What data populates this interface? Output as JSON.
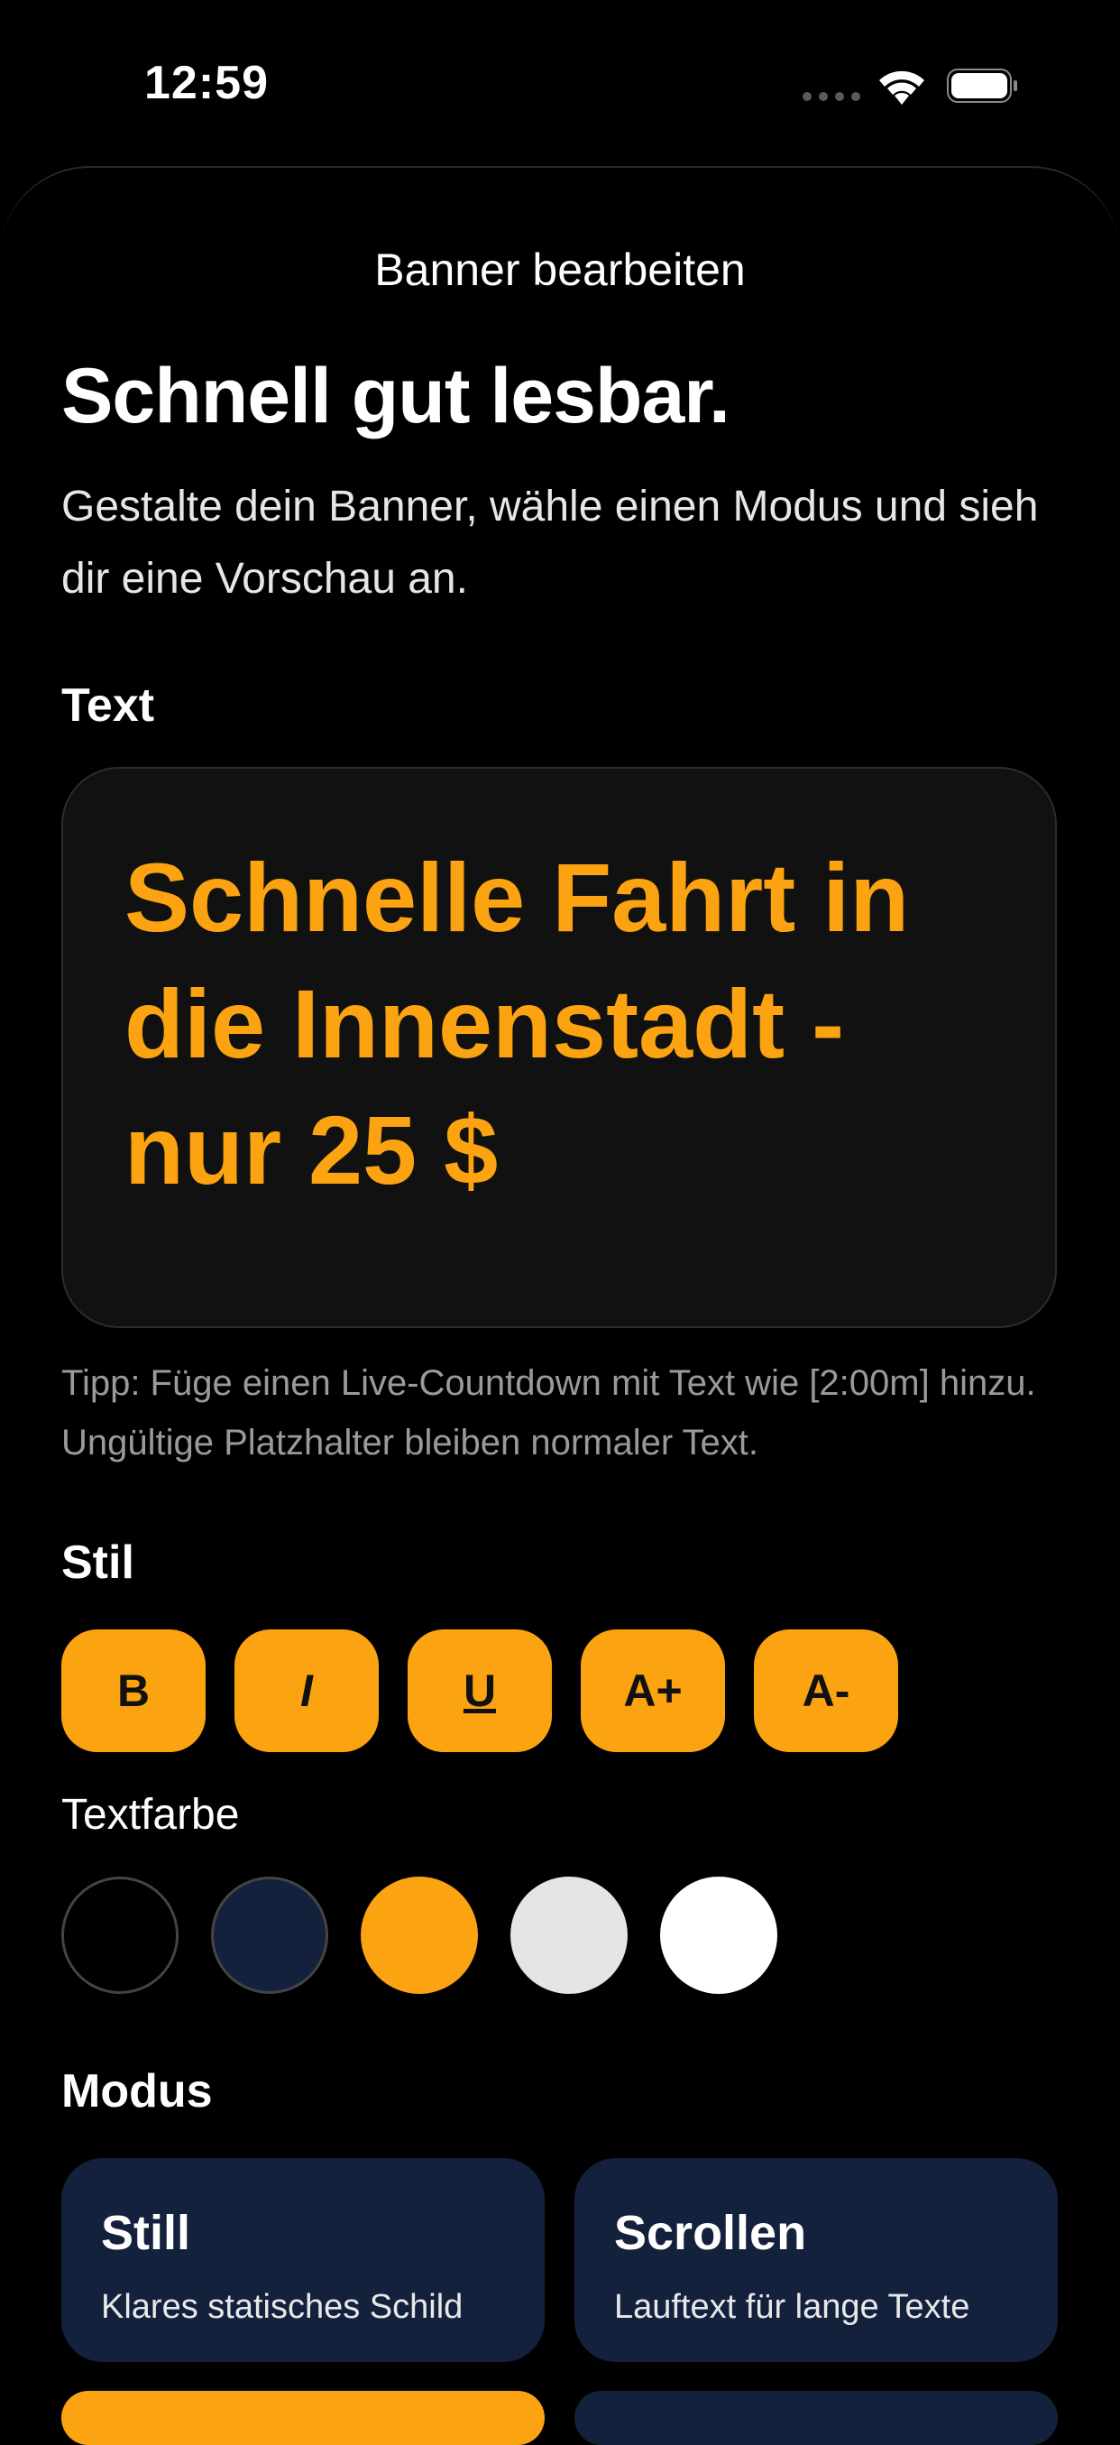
{
  "status_bar": {
    "time": "12:59"
  },
  "sheet": {
    "title": "Banner bearbeiten",
    "headline": "Schnell gut lesbar.",
    "subtitle": "Gestalte dein Banner, wähle einen Modus und sieh dir eine Vorschau an."
  },
  "text_section": {
    "label": "Text",
    "banner_text": "Schnelle Fahrt in die Innenstadt - nur 25 $",
    "banner_text_color": "#fca311",
    "tip": "Tipp: Füge einen Live-Countdown mit Text wie [2:00m] hinzu. Ungültige Platzhalter bleiben normaler Text."
  },
  "style_section": {
    "label": "Stil",
    "buttons": [
      {
        "label": "B",
        "name": "bold-button"
      },
      {
        "label": "I",
        "name": "italic-button"
      },
      {
        "label": "U",
        "name": "underline-button"
      },
      {
        "label": "A+",
        "name": "increase-size-button"
      },
      {
        "label": "A-",
        "name": "decrease-size-button"
      }
    ],
    "accent_color": "#fca311"
  },
  "text_color_section": {
    "label": "Textfarbe",
    "swatches": [
      "#000000",
      "#14213d",
      "#fca311",
      "#e5e5e5",
      "#ffffff"
    ],
    "selected": "#fca311"
  },
  "mode_section": {
    "label": "Modus",
    "modes": [
      {
        "title": "Still",
        "description": "Klares statisches Schild"
      },
      {
        "title": "Scrollen",
        "description": "Lauftext für lange Texte"
      }
    ],
    "card_color": "#14213d"
  }
}
